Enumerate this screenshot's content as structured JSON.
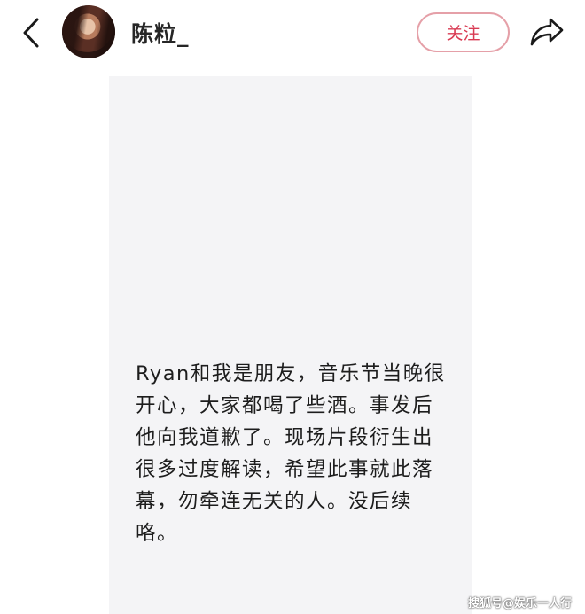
{
  "header": {
    "username": "陈粒_",
    "follow_label": "关注"
  },
  "post": {
    "lines": [
      "Ryan和我是朋友，音乐节当晚很",
      "开心，大家都喝了些酒。事发后",
      "他向我道歉了。现场片段衍生出",
      "很多过度解读，希望此事就此落",
      "幕，勿牵连无关的人。没后续",
      "咯。"
    ]
  },
  "watermark": "搜狐号@娱乐一人行",
  "icons": {
    "back": "chevron-left-icon",
    "share": "share-arrow-icon"
  },
  "colors": {
    "follow_accent": "#d93b53",
    "follow_border": "#e5a0a8",
    "card_background": "#f4f4f6"
  }
}
